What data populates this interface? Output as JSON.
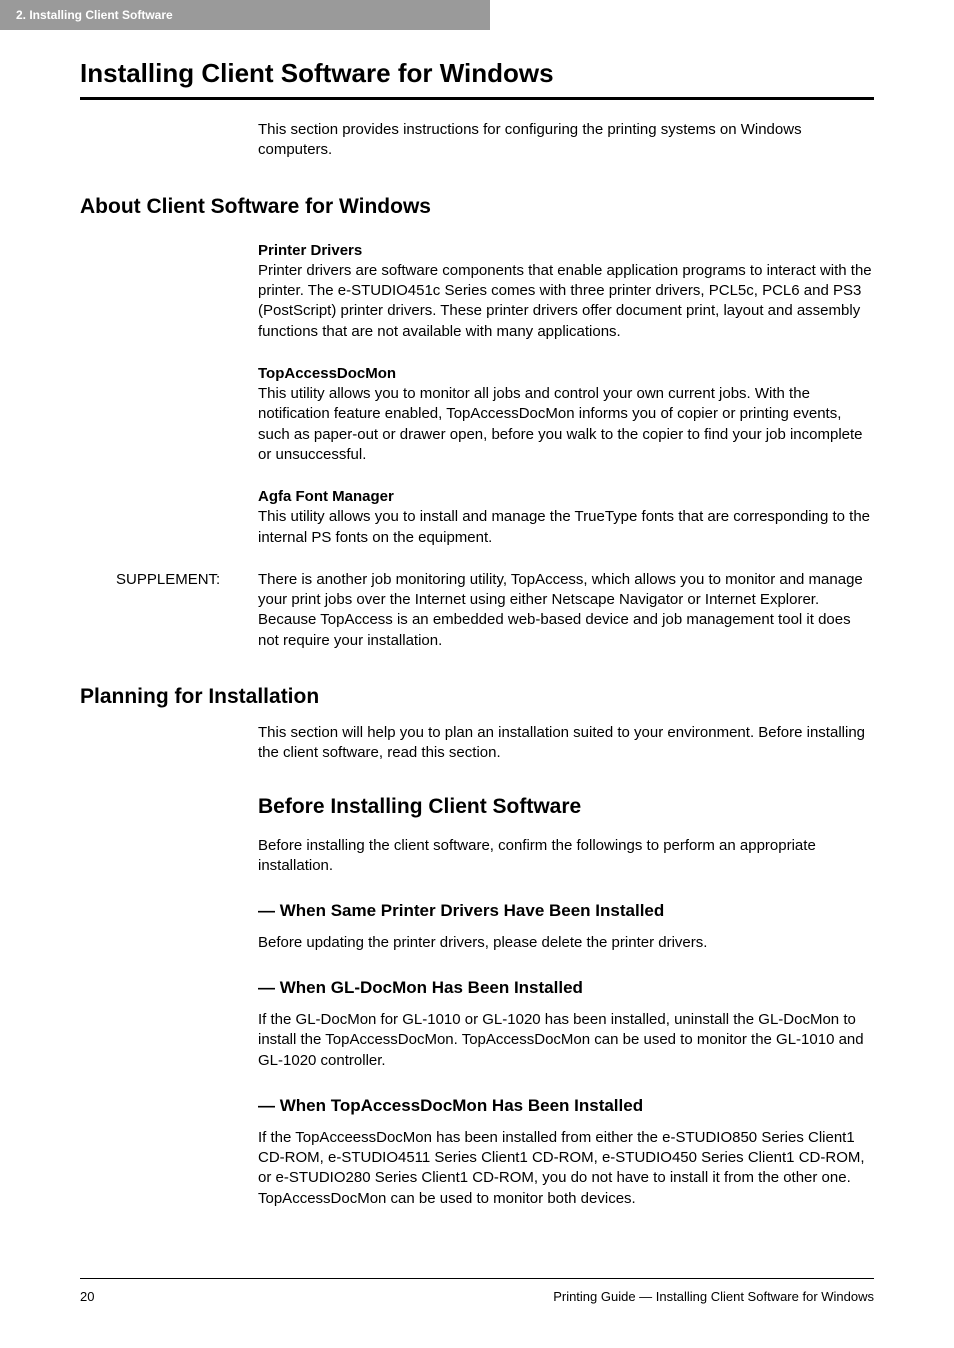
{
  "chapterTab": "2. Installing Client Software",
  "h1": "Installing Client Software for Windows",
  "intro": "This section provides instructions for configuring the printing systems on Windows computers.",
  "sect1": {
    "title": "About Client Software for Windows",
    "blocks": [
      {
        "heading": "Printer Drivers",
        "body": "Printer drivers are software components that enable application programs to interact with the printer. The e-STUDIO451c Series comes with three printer drivers, PCL5c, PCL6 and PS3 (PostScript) printer drivers.  These printer drivers offer document print, layout and assembly functions that are not available with many applications."
      },
      {
        "heading": "TopAccessDocMon",
        "body": "This utility allows you to monitor all jobs and control your own current jobs. With the notification feature enabled, TopAccessDocMon informs you of copier or printing events, such as paper-out or drawer open, before you walk to the copier to find your job incomplete or unsuccessful."
      },
      {
        "heading": "Agfa Font Manager",
        "body": "This utility allows you to install and manage the TrueType fonts that are corresponding to the internal PS fonts on the equipment."
      }
    ],
    "supplement": {
      "label": "SUPPLEMENT:",
      "text": "There is another job monitoring utility, TopAccess, which allows you to monitor and manage your print jobs over the Internet using either Netscape Navigator or Internet Explorer.  Because TopAccess is an embedded web-based device and job management tool it does not require your installation."
    }
  },
  "sect2": {
    "title": "Planning for Installation",
    "intro": "This section will help you to plan an installation suited to your environment.  Before installing the client software, read this section.",
    "subTitle": "Before Installing Client Software",
    "subIntro": "Before installing the client software, confirm the followings to perform an appropriate installation.",
    "subs": [
      {
        "heading": "— When Same Printer Drivers Have Been Installed",
        "body": "Before updating the printer drivers, please delete the printer drivers."
      },
      {
        "heading": "— When GL-DocMon Has Been Installed",
        "body": "If the GL-DocMon for GL-1010 or GL-1020 has been installed, uninstall the GL-DocMon to install the TopAccessDocMon.  TopAccessDocMon can be used to monitor the GL-1010 and GL-1020 controller."
      },
      {
        "heading": "— When TopAccessDocMon Has Been Installed",
        "body": "If the TopAcceessDocMon has been installed from either the e-STUDIO850 Series Client1 CD-ROM,  e-STUDIO4511 Series Client1 CD-ROM, e-STUDIO450 Series Client1 CD-ROM, or e-STUDIO280 Series Client1 CD-ROM, you do not have to install it from the other one.  TopAccessDocMon can be used to monitor both devices."
      }
    ]
  },
  "footer": {
    "pageNum": "20",
    "right": "Printing Guide — Installing Client Software for Windows"
  }
}
